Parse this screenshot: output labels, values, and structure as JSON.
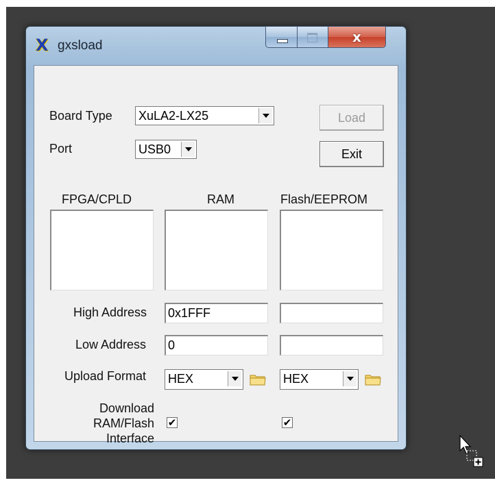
{
  "window": {
    "title": "gxsload",
    "app_icon": "X",
    "close_glyph": "x"
  },
  "board": {
    "label": "Board Type",
    "value": "XuLA2-LX25"
  },
  "port": {
    "label": "Port",
    "value": "USB0"
  },
  "buttons": {
    "load": "Load",
    "exit": "Exit"
  },
  "columns": {
    "fpga": "FPGA/CPLD",
    "ram": "RAM",
    "flash": "Flash/EEPROM"
  },
  "high_address": {
    "label": "High Address",
    "ram_value": "0x1FFF",
    "flash_value": ""
  },
  "low_address": {
    "label": "Low Address",
    "ram_value": "0",
    "flash_value": ""
  },
  "upload_format": {
    "label": "Upload Format",
    "ram_value": "HEX",
    "flash_value": "HEX"
  },
  "download_interface": {
    "label_line1": "Download",
    "label_line2": "RAM/Flash",
    "label_line3": "Interface",
    "ram_checked": true,
    "flash_checked": true,
    "check_glyph": "✔"
  },
  "colors": {
    "desktop": "#3d3d3d",
    "client": "#f0f0f0",
    "title_gradient_top": "#b9d0e6",
    "close_button": "#c7402a",
    "folder_icon": "#f3d36a"
  },
  "icons": [
    "gxsload-app-icon",
    "minimize-icon",
    "maximize-icon",
    "close-icon",
    "folder-icon",
    "mouse-pointer-copy-icon"
  ]
}
